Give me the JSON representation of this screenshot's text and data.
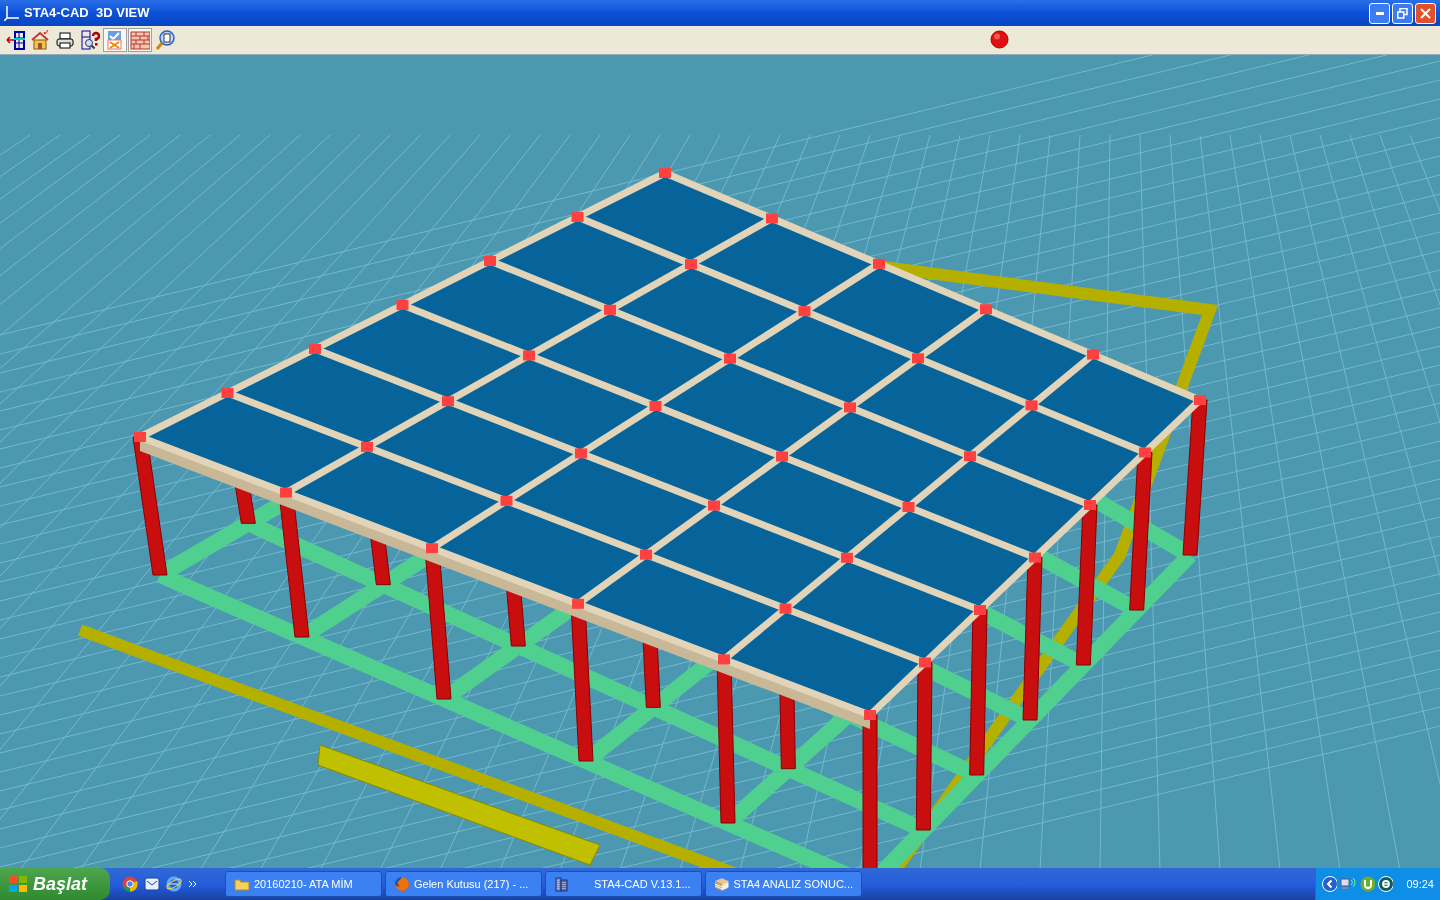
{
  "window": {
    "title": "STA4-CAD  3D VIEW"
  },
  "toolbar": [
    {
      "kind": "exit",
      "pressed": false
    },
    {
      "kind": "home",
      "pressed": false
    },
    {
      "kind": "print",
      "pressed": false
    },
    {
      "kind": "help",
      "pressed": false
    },
    {
      "kind": "check",
      "pressed": true
    },
    {
      "kind": "wall",
      "pressed": true
    },
    {
      "kind": "preview",
      "pressed": false
    }
  ],
  "taskbar": {
    "start": "Başlat",
    "tasks": [
      {
        "kind": "folder",
        "label": "20160210-  ATA MİM"
      },
      {
        "kind": "browser",
        "label": "Gelen Kutusu (217) - ..."
      },
      {
        "kind": "building",
        "label": "STA4-CAD  V.13.1..."
      },
      {
        "kind": "box",
        "label": "STA4 ANALIZ SONUC..."
      }
    ],
    "clock": "09:24"
  }
}
